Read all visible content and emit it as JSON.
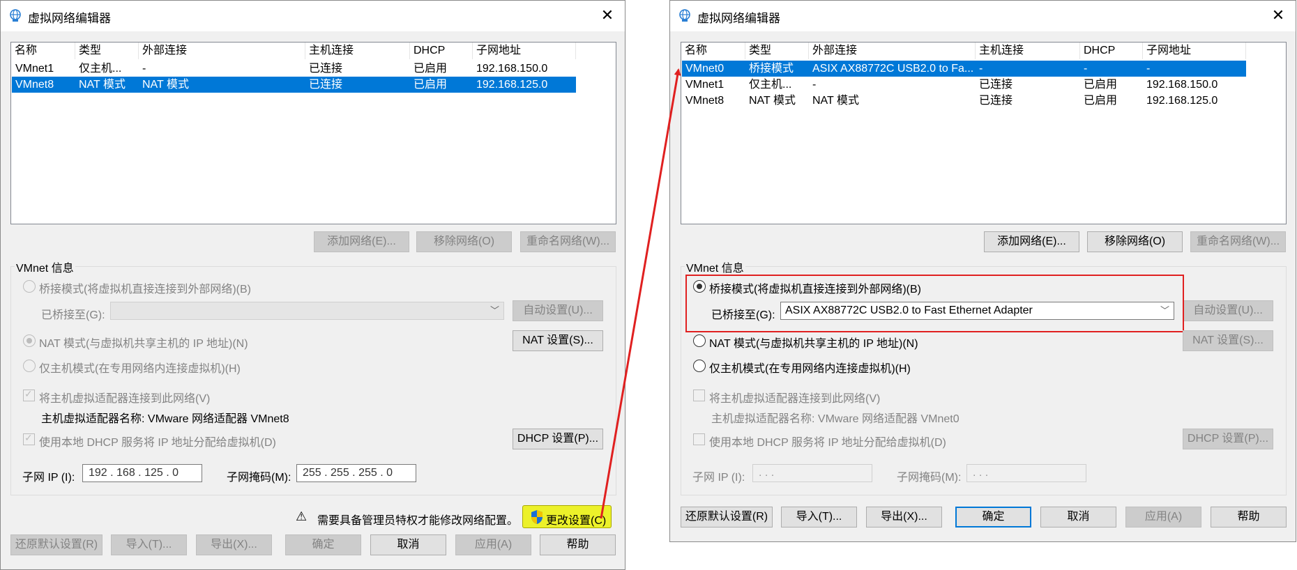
{
  "left": {
    "title": "虚拟网络编辑器",
    "columns": [
      "名称",
      "类型",
      "外部连接",
      "主机连接",
      "DHCP",
      "子网地址"
    ],
    "rows": [
      {
        "name": "VMnet1",
        "type": "仅主机...",
        "ext": "-",
        "host": "已连接",
        "dhcp": "已启用",
        "subnet": "192.168.150.0"
      },
      {
        "name": "VMnet8",
        "type": "NAT 模式",
        "ext": "NAT 模式",
        "host": "已连接",
        "dhcp": "已启用",
        "subnet": "192.168.125.0"
      }
    ],
    "add_net": "添加网络(E)...",
    "remove_net": "移除网络(O)",
    "rename_net": "重命名网络(W)...",
    "vmnet_info": "VMnet 信息",
    "bridge_radio": "桥接模式(将虚拟机直接连接到外部网络)(B)",
    "bridged_to": "已桥接至(G):",
    "auto_settings": "自动设置(U)...",
    "nat_radio": "NAT 模式(与虚拟机共享主机的 IP 地址)(N)",
    "nat_settings": "NAT 设置(S)...",
    "hostonly_radio": "仅主机模式(在专用网络内连接虚拟机)(H)",
    "connect_adapter": "将主机虚拟适配器连接到此网络(V)",
    "adapter_name": "主机虚拟适配器名称: VMware 网络适配器 VMnet8",
    "use_dhcp": "使用本地 DHCP 服务将 IP 地址分配给虚拟机(D)",
    "dhcp_settings": "DHCP 设置(P)...",
    "subnet_ip_label": "子网 IP (I):",
    "subnet_ip": "192 . 168 . 125 .  0",
    "mask_label": "子网掩码(M):",
    "mask": "255 . 255 . 255 .  0",
    "warning": "需要具备管理员特权才能修改网络配置。",
    "change_settings": "更改设置(C)",
    "restore": "还原默认设置(R)",
    "import": "导入(T)...",
    "export": "导出(X)...",
    "ok": "确定",
    "cancel": "取消",
    "apply": "应用(A)",
    "help": "帮助"
  },
  "right": {
    "title": "虚拟网络编辑器",
    "columns": [
      "名称",
      "类型",
      "外部连接",
      "主机连接",
      "DHCP",
      "子网地址"
    ],
    "rows": [
      {
        "name": "VMnet0",
        "type": "桥接模式",
        "ext": "ASIX AX88772C USB2.0 to Fa...",
        "host": "-",
        "dhcp": "-",
        "subnet": "-"
      },
      {
        "name": "VMnet1",
        "type": "仅主机...",
        "ext": "-",
        "host": "已连接",
        "dhcp": "已启用",
        "subnet": "192.168.150.0"
      },
      {
        "name": "VMnet8",
        "type": "NAT 模式",
        "ext": "NAT 模式",
        "host": "已连接",
        "dhcp": "已启用",
        "subnet": "192.168.125.0"
      }
    ],
    "add_net": "添加网络(E)...",
    "remove_net": "移除网络(O)",
    "rename_net": "重命名网络(W)...",
    "vmnet_info": "VMnet 信息",
    "bridge_radio": "桥接模式(将虚拟机直接连接到外部网络)(B)",
    "bridged_to": "已桥接至(G):",
    "bridged_value": "ASIX AX88772C USB2.0 to Fast Ethernet Adapter",
    "auto_settings": "自动设置(U)...",
    "nat_radio": "NAT 模式(与虚拟机共享主机的 IP 地址)(N)",
    "nat_settings": "NAT 设置(S)...",
    "hostonly_radio": "仅主机模式(在专用网络内连接虚拟机)(H)",
    "connect_adapter": "将主机虚拟适配器连接到此网络(V)",
    "adapter_name": "主机虚拟适配器名称: VMware 网络适配器 VMnet0",
    "use_dhcp": "使用本地 DHCP 服务将 IP 地址分配给虚拟机(D)",
    "dhcp_settings": "DHCP 设置(P)...",
    "subnet_ip_label": "子网 IP (I):",
    "subnet_ip": "   .    .    .",
    "mask_label": "子网掩码(M):",
    "mask": "   .    .    .",
    "restore": "还原默认设置(R)",
    "import": "导入(T)...",
    "export": "导出(X)...",
    "ok": "确定",
    "cancel": "取消",
    "apply": "应用(A)",
    "help": "帮助"
  },
  "colors": {
    "selection": "#0078d7",
    "highlight_red": "#e02020",
    "highlight_yellow": "#ecf12a"
  }
}
